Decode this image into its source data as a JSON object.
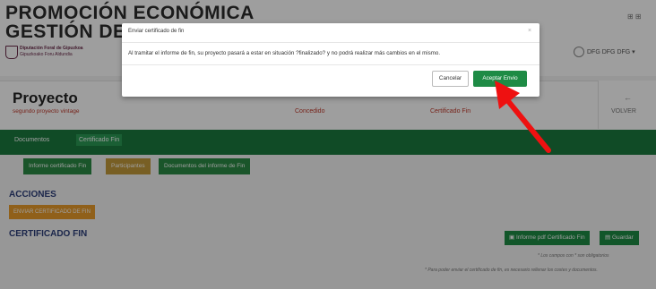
{
  "header": {
    "title_line1": "PROMOCIÓN ECONÓMICA",
    "title_line2": "GESTIÓN DE S",
    "logo_line1": "Diputación Foral de Gipuzkoa",
    "logo_line2": "Gipuzkoako Foru Aldundia",
    "top_icons": "⊞  ⊞",
    "user": "DFG DFG DFG"
  },
  "project": {
    "title": "Proyecto",
    "subtitle": "segundo proyecto vintage",
    "estado": "Concedido",
    "fase": "Certificado Fin",
    "back_arrow": "←",
    "back_label": "VOLVER"
  },
  "tabs": [
    "Documentos",
    "Certificado Fin"
  ],
  "subtabs": [
    "Informe certificado Fin",
    "Participantes",
    "Documentos del informe de Fin"
  ],
  "sections": {
    "acciones": "ACCIONES",
    "enviar_button": "ENVIAR CERTIFICADO DE FIN",
    "certificado": "CERTIFICADO FIN",
    "pdf_button": "Informe pdf Certificado Fin",
    "guardar_button": "Guardar",
    "note_required": "* Los campos con * son obligatorios",
    "note_costs": "* Para poder enviar el certificado de fin, es necesario rellenar los costes y documentos."
  },
  "modal": {
    "title": "Enviar certificado de fin",
    "close": "×",
    "body": "Al tramitar el informe de fin, su proyecto pasará a estar en situación ?finalizado? y no podrá realizar más cambios en el mismo.",
    "cancel": "Cancelar",
    "accept": "Aceptar Envio"
  },
  "colors": {
    "primary_green": "#1e8b45",
    "tab_bar": "#1a7a3e",
    "orange": "#e89c2a",
    "annotation_arrow": "#ee1111"
  }
}
